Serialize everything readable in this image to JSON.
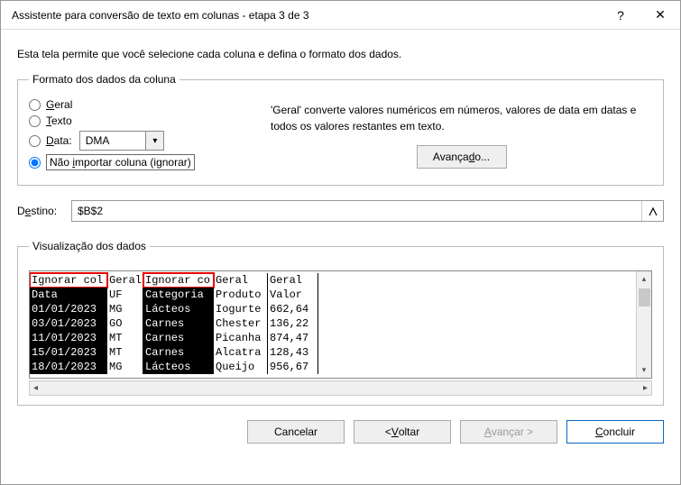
{
  "window": {
    "title": "Assistente para conversão de texto em colunas - etapa 3 de 3",
    "help": "?",
    "close": "✕"
  },
  "intro": "Esta tela permite que você selecione cada coluna e defina o formato dos dados.",
  "format_group": {
    "legend": "Formato dos dados da coluna",
    "radios": {
      "geral": "Geral",
      "texto": "Texto",
      "data": "Data:",
      "ignorar": "Não importar coluna (ignorar)"
    },
    "date_format_value": "DMA",
    "hint": "'Geral' converte valores numéricos em números, valores de data em datas e todos os valores restantes em texto.",
    "advanced": "Avançado..."
  },
  "destination": {
    "label": "Destino:",
    "value": "$B$2"
  },
  "preview": {
    "legend": "Visualização dos dados",
    "headers": [
      "Ignorar col",
      "Geral",
      "Ignorar co",
      "Geral",
      "Geral"
    ],
    "rows": [
      [
        "Data",
        "UF",
        "Categoria",
        "Produto",
        "Valor"
      ],
      [
        "01/01/2023",
        "MG",
        "Lácteos",
        "Iogurte",
        "662,64"
      ],
      [
        "03/01/2023",
        "GO",
        "Carnes",
        "Chester",
        "136,22"
      ],
      [
        "11/01/2023",
        "MT",
        "Carnes",
        "Picanha",
        "874,47"
      ],
      [
        "15/01/2023",
        "MT",
        "Carnes",
        "Alcatra",
        "128,43"
      ],
      [
        "18/01/2023",
        "MG",
        "Lácteos",
        "Queijo",
        "956,67"
      ]
    ]
  },
  "footer": {
    "cancel": "Cancelar",
    "back": "< Voltar",
    "next": "Avançar >",
    "finish": "Concluir"
  },
  "underline_map": {
    "Geral": "G",
    "Texto": "T",
    "Data:": "D",
    "Não importar coluna (ignorar)": "i",
    "Avançado...": "d",
    "Destino:": "e",
    "< Voltar": "V",
    "Avançar >": "A",
    "Concluir": "C"
  }
}
